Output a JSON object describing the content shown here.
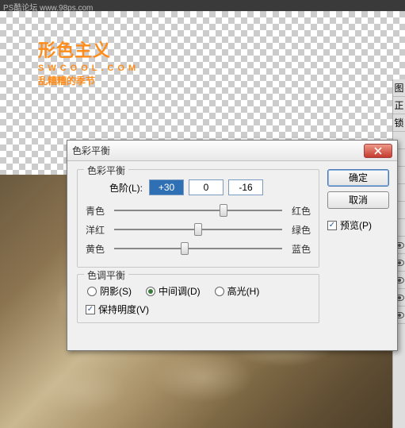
{
  "top_strip": "PS酷论坛 www.98ps.com",
  "watermark": {
    "line1": "形色主义",
    "line2": "SWCOOL.COM",
    "line3": "乱糟糟的季节"
  },
  "dialog": {
    "title": "色彩平衡",
    "group1_legend": "色彩平衡",
    "levels_label": "色阶(L):",
    "levels": {
      "a": "+30",
      "b": "0",
      "c": "-16"
    },
    "sliders": [
      {
        "left": "青色",
        "right": "红色",
        "pos": 65
      },
      {
        "left": "洋红",
        "right": "绿色",
        "pos": 50
      },
      {
        "left": "黄色",
        "right": "蓝色",
        "pos": 42
      }
    ],
    "group2_legend": "色调平衡",
    "radios": {
      "shadow": "阴影(S)",
      "mid": "中间调(D)",
      "high": "高光(H)"
    },
    "preserve": "保持明度(V)",
    "buttons": {
      "ok": "确定",
      "cancel": "取消"
    },
    "preview": "预览(P)"
  },
  "side": {
    "header1": "图",
    "header2": "正",
    "header3": "锁"
  }
}
